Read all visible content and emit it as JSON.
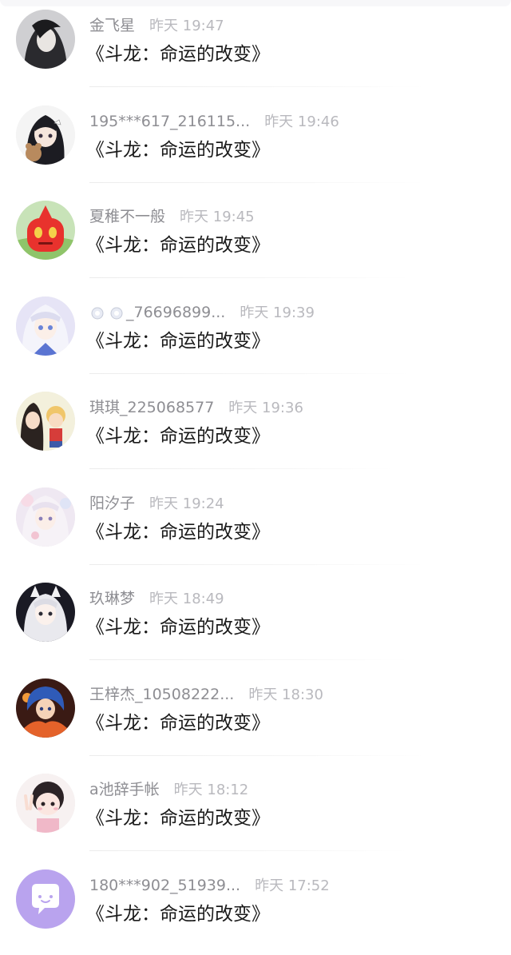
{
  "items": [
    {
      "name": "金飞星",
      "time": "昨天 19:47",
      "message": "《斗龙：命运的改变》",
      "avatar": "avatar-dark-haired-figure"
    },
    {
      "name": "195***617_216115...",
      "time": "昨天 19:46",
      "message": "《斗龙：命运的改变》",
      "avatar": "avatar-anime-girl-with-bear"
    },
    {
      "name": "夏稚不一般",
      "time": "昨天 19:45",
      "message": "《斗龙：命运的改变》",
      "avatar": "avatar-red-robot"
    },
    {
      "name": "_76696899...",
      "time": "昨天 19:39",
      "message": "《斗龙：命运的改变》",
      "avatar": "avatar-white-haired-anime-girl"
    },
    {
      "name": "琪琪_225068577",
      "time": "昨天 19:36",
      "message": "《斗龙：命运的改变》",
      "avatar": "avatar-cartoon-kids"
    },
    {
      "name": "阳汐子",
      "time": "昨天 19:24",
      "message": "《斗龙：命运的改变》",
      "avatar": "avatar-pastel-anime-girl"
    },
    {
      "name": "玖琳梦",
      "time": "昨天 18:49",
      "message": "《斗龙：命运的改变》",
      "avatar": "avatar-cat-ear-anime-girl"
    },
    {
      "name": "王梓杰_10508222...",
      "time": "昨天 18:30",
      "message": "《斗龙：命运的改变》",
      "avatar": "avatar-anime-boy-fire"
    },
    {
      "name": "a池辞手帐",
      "time": "昨天 18:12",
      "message": "《斗龙：命运的改变》",
      "avatar": "avatar-chibi-peace-sign"
    },
    {
      "name": "180***902_51939...",
      "time": "昨天 17:52",
      "message": "《斗龙：命运的改变》",
      "avatar": "avatar-default-chat-bubble"
    }
  ],
  "colors": {
    "name": "#8e8e93",
    "time": "#b9b9be",
    "message": "#1a1a1a",
    "default_avatar": "#b9a3ee"
  }
}
